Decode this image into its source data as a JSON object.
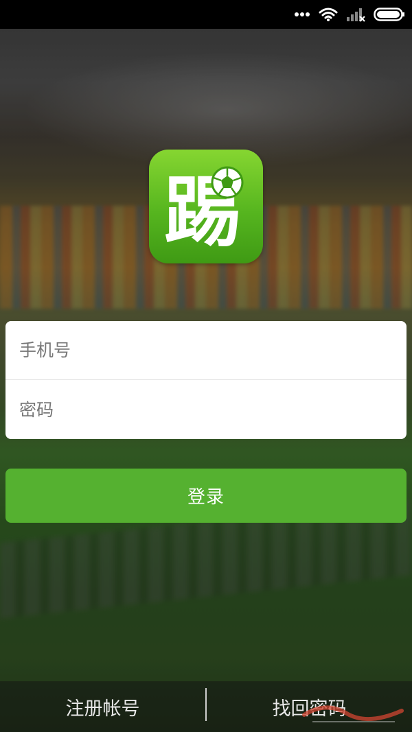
{
  "status_bar": {
    "icons": [
      "more-dots-icon",
      "wifi-icon",
      "signal-icon",
      "battery-icon"
    ]
  },
  "logo": {
    "glyph": "踢",
    "icon": "soccer-ball-icon",
    "color": "#5cb721"
  },
  "login_form": {
    "phone_placeholder": "手机号",
    "password_placeholder": "密码",
    "phone_value": "",
    "password_value": ""
  },
  "login_button": {
    "label": "登录",
    "color": "#55b130"
  },
  "bottom_bar": {
    "register_label": "注册帐号",
    "forgot_label": "找回密码"
  }
}
